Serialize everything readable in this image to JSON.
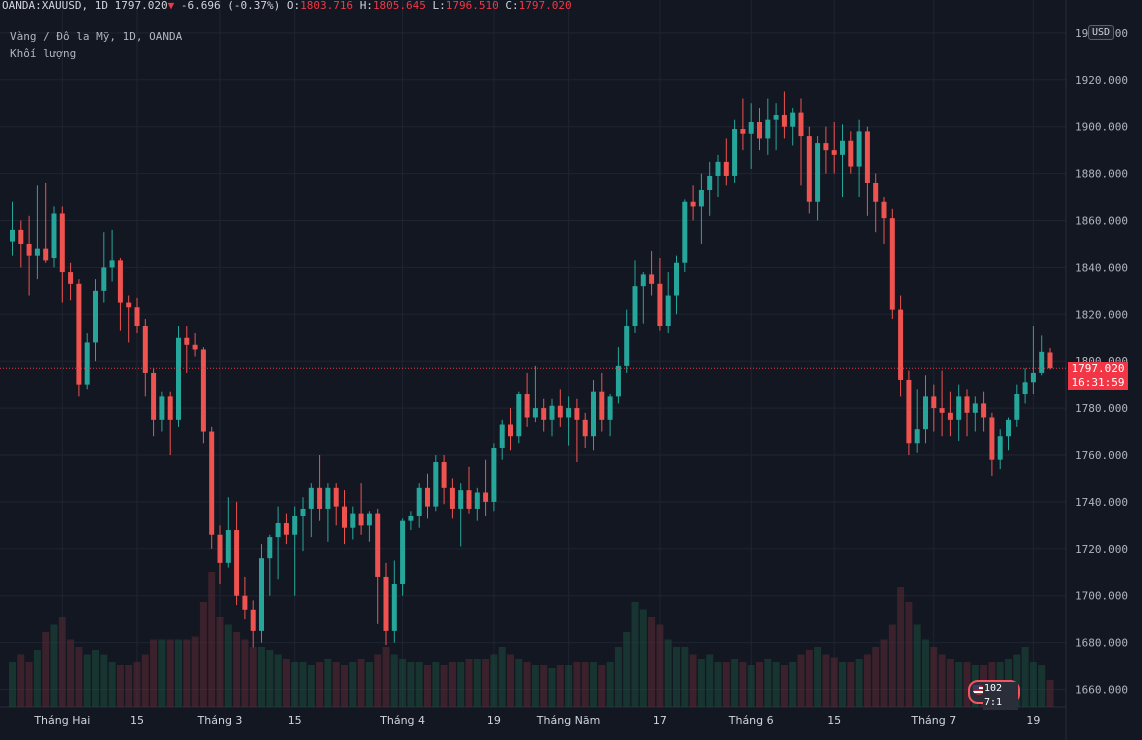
{
  "header": {
    "symbol": "OANDA:XAUUSD",
    "interval": "1D",
    "last_price": "1797.020",
    "change_arrow": "▼",
    "change": "-6.696",
    "change_pct": "(-0.37%)",
    "open_label": "O:",
    "open": "1803.716",
    "high_label": "H:",
    "high": "1805.645",
    "low_label": "L:",
    "low": "1796.510",
    "close_label": "C:",
    "close": "1797.020"
  },
  "legend": {
    "title": "Vàng / Đô la Mỹ, 1D, OANDA",
    "volume": "Khối lượng"
  },
  "price_tag": {
    "price": "1797.020",
    "countdown": "16:31:59"
  },
  "currency_badge": "USD",
  "event_badge": {
    "text": "102 7:1"
  },
  "colors": {
    "up": "#26a69a",
    "down": "#ef5350",
    "background": "#131722",
    "grid": "#1f2433",
    "last_price_line": "#f23645"
  },
  "chart_data": {
    "type": "candlestick",
    "title": "Vàng / Đô la Mỹ, 1D, OANDA",
    "ylim": [
      1650,
      1930
    ],
    "y_ticks": [
      "1660.000",
      "1680.000",
      "1700.000",
      "1720.000",
      "1740.000",
      "1760.000",
      "1780.000",
      "1800.000",
      "1820.000",
      "1840.000",
      "1860.000",
      "1880.000",
      "1900.000",
      "1920.000",
      "1940.000"
    ],
    "x_ticks": [
      {
        "label": "Tháng Hai",
        "index": 6
      },
      {
        "label": "15",
        "index": 15
      },
      {
        "label": "Tháng 3",
        "index": 25
      },
      {
        "label": "15",
        "index": 34
      },
      {
        "label": "Tháng 4",
        "index": 47
      },
      {
        "label": "19",
        "index": 58
      },
      {
        "label": "Tháng Năm",
        "index": 67
      },
      {
        "label": "17",
        "index": 78
      },
      {
        "label": "Tháng 6",
        "index": 89
      },
      {
        "label": "15",
        "index": 99
      },
      {
        "label": "Tháng 7",
        "index": 111
      },
      {
        "label": "19",
        "index": 123
      }
    ],
    "last_price": 1797.02,
    "candles": [
      {
        "o": 1851,
        "h": 1868,
        "l": 1845,
        "c": 1856,
        "v": 0.3
      },
      {
        "o": 1856,
        "h": 1860,
        "l": 1840,
        "c": 1850,
        "v": 0.35
      },
      {
        "o": 1850,
        "h": 1862,
        "l": 1828,
        "c": 1845,
        "v": 0.3
      },
      {
        "o": 1845,
        "h": 1875,
        "l": 1835,
        "c": 1848,
        "v": 0.38
      },
      {
        "o": 1848,
        "h": 1876,
        "l": 1842,
        "c": 1843,
        "v": 0.5
      },
      {
        "o": 1844,
        "h": 1866,
        "l": 1840,
        "c": 1863,
        "v": 0.55
      },
      {
        "o": 1863,
        "h": 1866,
        "l": 1825,
        "c": 1838,
        "v": 0.6
      },
      {
        "o": 1838,
        "h": 1842,
        "l": 1826,
        "c": 1833,
        "v": 0.45
      },
      {
        "o": 1833,
        "h": 1835,
        "l": 1785,
        "c": 1790,
        "v": 0.4
      },
      {
        "o": 1790,
        "h": 1812,
        "l": 1788,
        "c": 1808,
        "v": 0.35
      },
      {
        "o": 1808,
        "h": 1835,
        "l": 1800,
        "c": 1830,
        "v": 0.38
      },
      {
        "o": 1830,
        "h": 1855,
        "l": 1825,
        "c": 1840,
        "v": 0.35
      },
      {
        "o": 1840,
        "h": 1856,
        "l": 1834,
        "c": 1843,
        "v": 0.3
      },
      {
        "o": 1843,
        "h": 1844,
        "l": 1813,
        "c": 1825,
        "v": 0.28
      },
      {
        "o": 1825,
        "h": 1828,
        "l": 1808,
        "c": 1823,
        "v": 0.28
      },
      {
        "o": 1823,
        "h": 1827,
        "l": 1812,
        "c": 1815,
        "v": 0.3
      },
      {
        "o": 1815,
        "h": 1818,
        "l": 1785,
        "c": 1795,
        "v": 0.35
      },
      {
        "o": 1795,
        "h": 1797,
        "l": 1768,
        "c": 1775,
        "v": 0.45
      },
      {
        "o": 1775,
        "h": 1787,
        "l": 1770,
        "c": 1785,
        "v": 0.45
      },
      {
        "o": 1785,
        "h": 1787,
        "l": 1760,
        "c": 1775,
        "v": 0.45
      },
      {
        "o": 1775,
        "h": 1815,
        "l": 1772,
        "c": 1810,
        "v": 0.45
      },
      {
        "o": 1810,
        "h": 1815,
        "l": 1795,
        "c": 1807,
        "v": 0.45
      },
      {
        "o": 1807,
        "h": 1812,
        "l": 1802,
        "c": 1805,
        "v": 0.47
      },
      {
        "o": 1805,
        "h": 1806,
        "l": 1765,
        "c": 1770,
        "v": 0.7
      },
      {
        "o": 1770,
        "h": 1772,
        "l": 1720,
        "c": 1726,
        "v": 0.9
      },
      {
        "o": 1726,
        "h": 1730,
        "l": 1705,
        "c": 1714,
        "v": 0.6
      },
      {
        "o": 1714,
        "h": 1742,
        "l": 1712,
        "c": 1728,
        "v": 0.55
      },
      {
        "o": 1728,
        "h": 1740,
        "l": 1696,
        "c": 1700,
        "v": 0.5
      },
      {
        "o": 1700,
        "h": 1708,
        "l": 1690,
        "c": 1694,
        "v": 0.45
      },
      {
        "o": 1694,
        "h": 1698,
        "l": 1678,
        "c": 1685,
        "v": 0.4
      },
      {
        "o": 1685,
        "h": 1722,
        "l": 1680,
        "c": 1716,
        "v": 0.4
      },
      {
        "o": 1716,
        "h": 1726,
        "l": 1700,
        "c": 1725,
        "v": 0.38
      },
      {
        "o": 1725,
        "h": 1738,
        "l": 1707,
        "c": 1731,
        "v": 0.35
      },
      {
        "o": 1731,
        "h": 1735,
        "l": 1722,
        "c": 1726,
        "v": 0.32
      },
      {
        "o": 1726,
        "h": 1738,
        "l": 1700,
        "c": 1734,
        "v": 0.3
      },
      {
        "o": 1734,
        "h": 1742,
        "l": 1719,
        "c": 1737,
        "v": 0.3
      },
      {
        "o": 1737,
        "h": 1748,
        "l": 1725,
        "c": 1746,
        "v": 0.28
      },
      {
        "o": 1746,
        "h": 1760,
        "l": 1732,
        "c": 1737,
        "v": 0.3
      },
      {
        "o": 1737,
        "h": 1748,
        "l": 1723,
        "c": 1746,
        "v": 0.32
      },
      {
        "o": 1746,
        "h": 1748,
        "l": 1730,
        "c": 1738,
        "v": 0.3
      },
      {
        "o": 1738,
        "h": 1745,
        "l": 1722,
        "c": 1729,
        "v": 0.28
      },
      {
        "o": 1729,
        "h": 1738,
        "l": 1724,
        "c": 1735,
        "v": 0.3
      },
      {
        "o": 1735,
        "h": 1748,
        "l": 1726,
        "c": 1730,
        "v": 0.32
      },
      {
        "o": 1730,
        "h": 1736,
        "l": 1723,
        "c": 1735,
        "v": 0.3
      },
      {
        "o": 1735,
        "h": 1737,
        "l": 1688,
        "c": 1708,
        "v": 0.35
      },
      {
        "o": 1708,
        "h": 1714,
        "l": 1679,
        "c": 1685,
        "v": 0.4
      },
      {
        "o": 1685,
        "h": 1715,
        "l": 1680,
        "c": 1705,
        "v": 0.35
      },
      {
        "o": 1705,
        "h": 1733,
        "l": 1700,
        "c": 1732,
        "v": 0.32
      },
      {
        "o": 1732,
        "h": 1736,
        "l": 1728,
        "c": 1734,
        "v": 0.3
      },
      {
        "o": 1734,
        "h": 1748,
        "l": 1729,
        "c": 1746,
        "v": 0.3
      },
      {
        "o": 1746,
        "h": 1752,
        "l": 1733,
        "c": 1738,
        "v": 0.28
      },
      {
        "o": 1738,
        "h": 1760,
        "l": 1736,
        "c": 1757,
        "v": 0.3
      },
      {
        "o": 1757,
        "h": 1760,
        "l": 1739,
        "c": 1746,
        "v": 0.28
      },
      {
        "o": 1746,
        "h": 1750,
        "l": 1733,
        "c": 1737,
        "v": 0.3
      },
      {
        "o": 1737,
        "h": 1748,
        "l": 1721,
        "c": 1745,
        "v": 0.3
      },
      {
        "o": 1745,
        "h": 1755,
        "l": 1735,
        "c": 1737,
        "v": 0.32
      },
      {
        "o": 1737,
        "h": 1746,
        "l": 1732,
        "c": 1744,
        "v": 0.32
      },
      {
        "o": 1744,
        "h": 1758,
        "l": 1734,
        "c": 1740,
        "v": 0.32
      },
      {
        "o": 1740,
        "h": 1765,
        "l": 1736,
        "c": 1763,
        "v": 0.35
      },
      {
        "o": 1763,
        "h": 1775,
        "l": 1758,
        "c": 1773,
        "v": 0.4
      },
      {
        "o": 1773,
        "h": 1780,
        "l": 1762,
        "c": 1768,
        "v": 0.35
      },
      {
        "o": 1768,
        "h": 1787,
        "l": 1765,
        "c": 1786,
        "v": 0.32
      },
      {
        "o": 1786,
        "h": 1795,
        "l": 1772,
        "c": 1776,
        "v": 0.3
      },
      {
        "o": 1776,
        "h": 1798,
        "l": 1774,
        "c": 1780,
        "v": 0.28
      },
      {
        "o": 1780,
        "h": 1784,
        "l": 1770,
        "c": 1775,
        "v": 0.28
      },
      {
        "o": 1775,
        "h": 1784,
        "l": 1768,
        "c": 1781,
        "v": 0.26
      },
      {
        "o": 1781,
        "h": 1788,
        "l": 1772,
        "c": 1776,
        "v": 0.28
      },
      {
        "o": 1776,
        "h": 1785,
        "l": 1764,
        "c": 1780,
        "v": 0.28
      },
      {
        "o": 1780,
        "h": 1784,
        "l": 1757,
        "c": 1775,
        "v": 0.3
      },
      {
        "o": 1775,
        "h": 1778,
        "l": 1763,
        "c": 1768,
        "v": 0.3
      },
      {
        "o": 1768,
        "h": 1792,
        "l": 1762,
        "c": 1787,
        "v": 0.3
      },
      {
        "o": 1787,
        "h": 1795,
        "l": 1770,
        "c": 1775,
        "v": 0.28
      },
      {
        "o": 1775,
        "h": 1786,
        "l": 1768,
        "c": 1785,
        "v": 0.3
      },
      {
        "o": 1785,
        "h": 1806,
        "l": 1782,
        "c": 1798,
        "v": 0.4
      },
      {
        "o": 1798,
        "h": 1822,
        "l": 1795,
        "c": 1815,
        "v": 0.5
      },
      {
        "o": 1815,
        "h": 1843,
        "l": 1812,
        "c": 1832,
        "v": 0.7
      },
      {
        "o": 1832,
        "h": 1838,
        "l": 1816,
        "c": 1837,
        "v": 0.65
      },
      {
        "o": 1837,
        "h": 1847,
        "l": 1828,
        "c": 1833,
        "v": 0.6
      },
      {
        "o": 1833,
        "h": 1844,
        "l": 1813,
        "c": 1815,
        "v": 0.55
      },
      {
        "o": 1815,
        "h": 1838,
        "l": 1812,
        "c": 1828,
        "v": 0.45
      },
      {
        "o": 1828,
        "h": 1845,
        "l": 1820,
        "c": 1842,
        "v": 0.4
      },
      {
        "o": 1842,
        "h": 1869,
        "l": 1838,
        "c": 1868,
        "v": 0.4
      },
      {
        "o": 1868,
        "h": 1875,
        "l": 1860,
        "c": 1866,
        "v": 0.35
      },
      {
        "o": 1866,
        "h": 1880,
        "l": 1850,
        "c": 1873,
        "v": 0.32
      },
      {
        "o": 1873,
        "h": 1885,
        "l": 1862,
        "c": 1879,
        "v": 0.35
      },
      {
        "o": 1879,
        "h": 1888,
        "l": 1870,
        "c": 1885,
        "v": 0.3
      },
      {
        "o": 1885,
        "h": 1895,
        "l": 1875,
        "c": 1879,
        "v": 0.3
      },
      {
        "o": 1879,
        "h": 1903,
        "l": 1876,
        "c": 1899,
        "v": 0.32
      },
      {
        "o": 1899,
        "h": 1912,
        "l": 1890,
        "c": 1897,
        "v": 0.3
      },
      {
        "o": 1897,
        "h": 1910,
        "l": 1882,
        "c": 1902,
        "v": 0.28
      },
      {
        "o": 1902,
        "h": 1908,
        "l": 1890,
        "c": 1895,
        "v": 0.3
      },
      {
        "o": 1895,
        "h": 1912,
        "l": 1888,
        "c": 1903,
        "v": 0.32
      },
      {
        "o": 1903,
        "h": 1910,
        "l": 1890,
        "c": 1905,
        "v": 0.3
      },
      {
        "o": 1905,
        "h": 1915,
        "l": 1895,
        "c": 1900,
        "v": 0.28
      },
      {
        "o": 1900,
        "h": 1908,
        "l": 1892,
        "c": 1906,
        "v": 0.3
      },
      {
        "o": 1906,
        "h": 1912,
        "l": 1875,
        "c": 1896,
        "v": 0.35
      },
      {
        "o": 1896,
        "h": 1900,
        "l": 1863,
        "c": 1868,
        "v": 0.38
      },
      {
        "o": 1868,
        "h": 1896,
        "l": 1860,
        "c": 1893,
        "v": 0.4
      },
      {
        "o": 1893,
        "h": 1900,
        "l": 1880,
        "c": 1890,
        "v": 0.35
      },
      {
        "o": 1890,
        "h": 1902,
        "l": 1880,
        "c": 1888,
        "v": 0.33
      },
      {
        "o": 1888,
        "h": 1901,
        "l": 1870,
        "c": 1894,
        "v": 0.3
      },
      {
        "o": 1894,
        "h": 1898,
        "l": 1880,
        "c": 1883,
        "v": 0.3
      },
      {
        "o": 1883,
        "h": 1903,
        "l": 1870,
        "c": 1898,
        "v": 0.32
      },
      {
        "o": 1898,
        "h": 1900,
        "l": 1862,
        "c": 1876,
        "v": 0.35
      },
      {
        "o": 1876,
        "h": 1880,
        "l": 1855,
        "c": 1868,
        "v": 0.4
      },
      {
        "o": 1868,
        "h": 1870,
        "l": 1850,
        "c": 1861,
        "v": 0.45
      },
      {
        "o": 1861,
        "h": 1865,
        "l": 1818,
        "c": 1822,
        "v": 0.55
      },
      {
        "o": 1822,
        "h": 1828,
        "l": 1785,
        "c": 1792,
        "v": 0.8
      },
      {
        "o": 1792,
        "h": 1796,
        "l": 1760,
        "c": 1765,
        "v": 0.7
      },
      {
        "o": 1765,
        "h": 1788,
        "l": 1761,
        "c": 1771,
        "v": 0.55
      },
      {
        "o": 1771,
        "h": 1794,
        "l": 1765,
        "c": 1785,
        "v": 0.45
      },
      {
        "o": 1785,
        "h": 1790,
        "l": 1770,
        "c": 1780,
        "v": 0.4
      },
      {
        "o": 1780,
        "h": 1796,
        "l": 1768,
        "c": 1778,
        "v": 0.35
      },
      {
        "o": 1778,
        "h": 1787,
        "l": 1768,
        "c": 1775,
        "v": 0.32
      },
      {
        "o": 1775,
        "h": 1790,
        "l": 1766,
        "c": 1785,
        "v": 0.3
      },
      {
        "o": 1785,
        "h": 1788,
        "l": 1768,
        "c": 1778,
        "v": 0.3
      },
      {
        "o": 1778,
        "h": 1785,
        "l": 1770,
        "c": 1782,
        "v": 0.28
      },
      {
        "o": 1782,
        "h": 1787,
        "l": 1770,
        "c": 1776,
        "v": 0.28
      },
      {
        "o": 1776,
        "h": 1778,
        "l": 1751,
        "c": 1758,
        "v": 0.3
      },
      {
        "o": 1758,
        "h": 1771,
        "l": 1754,
        "c": 1768,
        "v": 0.3
      },
      {
        "o": 1768,
        "h": 1776,
        "l": 1762,
        "c": 1775,
        "v": 0.32
      },
      {
        "o": 1775,
        "h": 1790,
        "l": 1772,
        "c": 1786,
        "v": 0.35
      },
      {
        "o": 1786,
        "h": 1797,
        "l": 1782,
        "c": 1791,
        "v": 0.4
      },
      {
        "o": 1791,
        "h": 1815,
        "l": 1786,
        "c": 1795,
        "v": 0.3
      },
      {
        "o": 1795,
        "h": 1811,
        "l": 1794,
        "c": 1804,
        "v": 0.28
      },
      {
        "o": 1803.716,
        "h": 1805.645,
        "l": 1796.51,
        "c": 1797.02,
        "v": 0.18
      }
    ]
  }
}
